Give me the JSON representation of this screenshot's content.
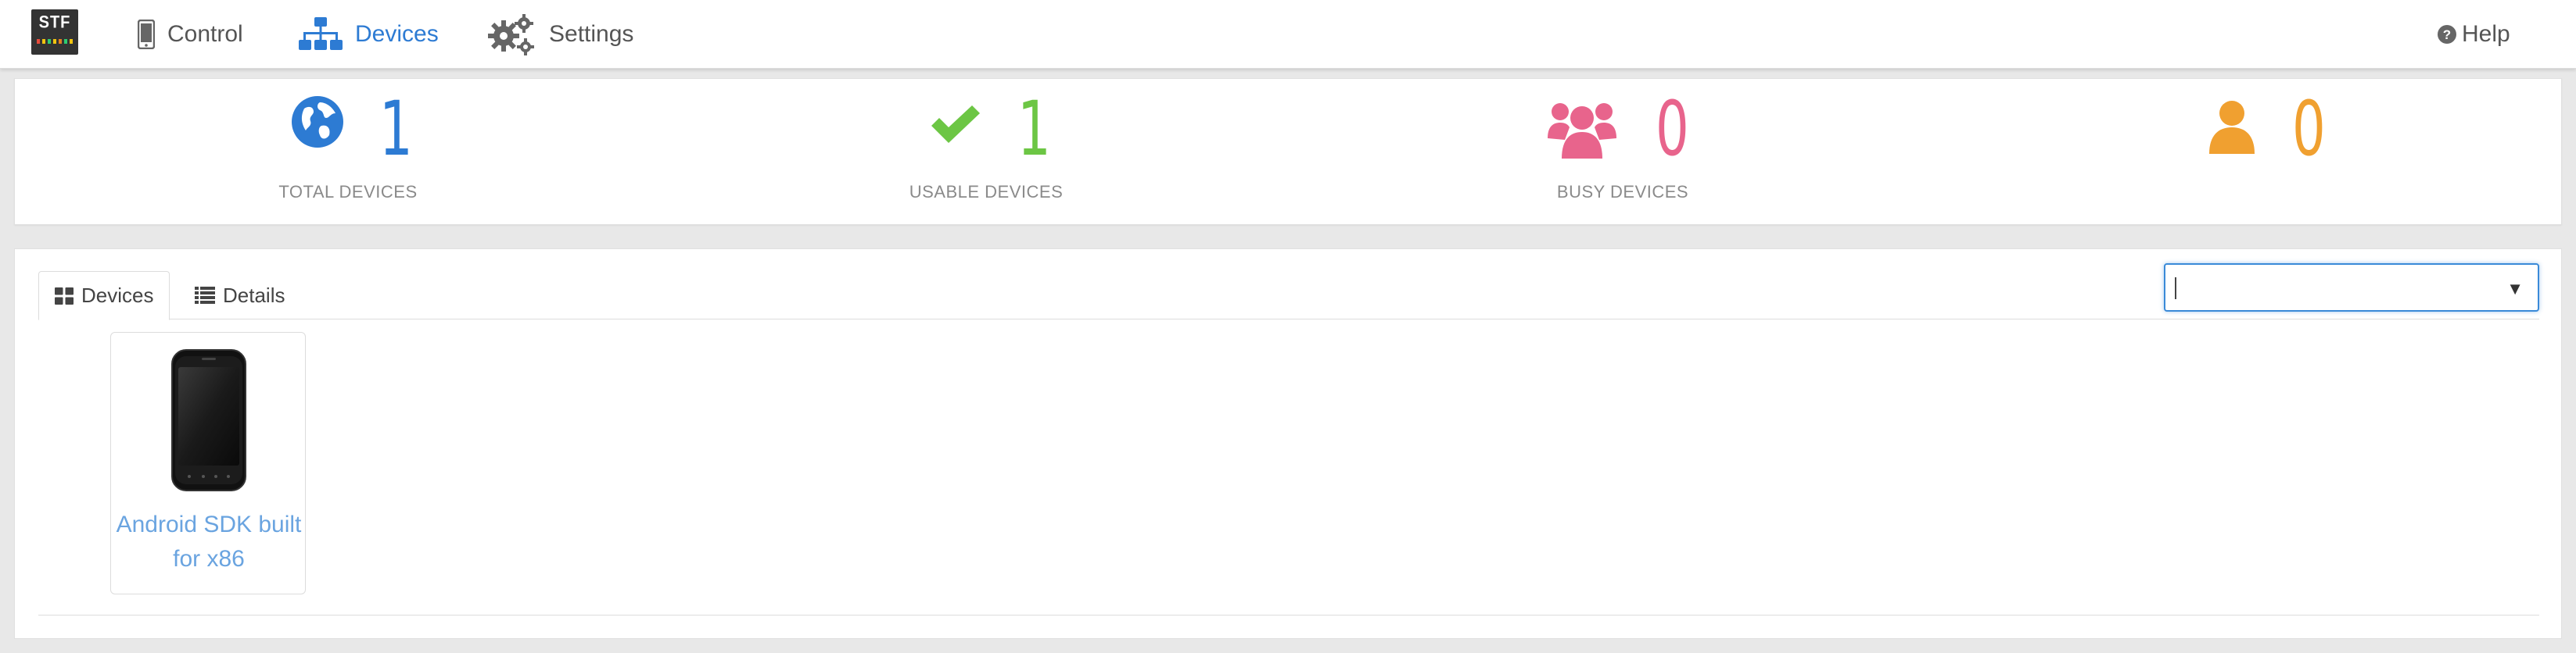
{
  "header": {
    "logo": {
      "text": "STF",
      "led_colors": [
        "#e74c3c",
        "#f1c40f",
        "#2ecc71",
        "#f1c40f",
        "#e67e22",
        "#2ecc71",
        "#f1c40f"
      ]
    },
    "nav": [
      {
        "label": "Control",
        "icon": "mobile-phone-icon",
        "active": false
      },
      {
        "label": "Devices",
        "icon": "sitemap-icon",
        "active": true
      },
      {
        "label": "Settings",
        "icon": "gears-icon",
        "active": false
      }
    ],
    "help": {
      "label": "Help",
      "icon": "question-circle-icon"
    }
  },
  "stats": {
    "total": {
      "value": "1",
      "label": "TOTAL DEVICES",
      "icon": "globe-icon",
      "color": "#2d7bd3"
    },
    "usable": {
      "value": "1",
      "label": "USABLE DEVICES",
      "icon": "check-icon",
      "color": "#6cc644"
    },
    "busy": {
      "value": "0",
      "label": "BUSY DEVICES",
      "icon": "users-icon",
      "color": "#e8648c"
    },
    "mine": {
      "value": "0",
      "label": "",
      "icon": "user-icon",
      "color": "#f0a030"
    }
  },
  "devices_panel": {
    "tabs": [
      {
        "label": "Devices",
        "icon": "th-large-icon",
        "active": true
      },
      {
        "label": "Details",
        "icon": "list-icon",
        "active": false
      }
    ],
    "filter": {
      "value": ""
    },
    "devices": [
      {
        "name": "Android SDK built for x86"
      }
    ]
  },
  "colors": {
    "accent": "#2d7bd3",
    "link": "#6aa4e0",
    "background": "#e8e8e8"
  }
}
